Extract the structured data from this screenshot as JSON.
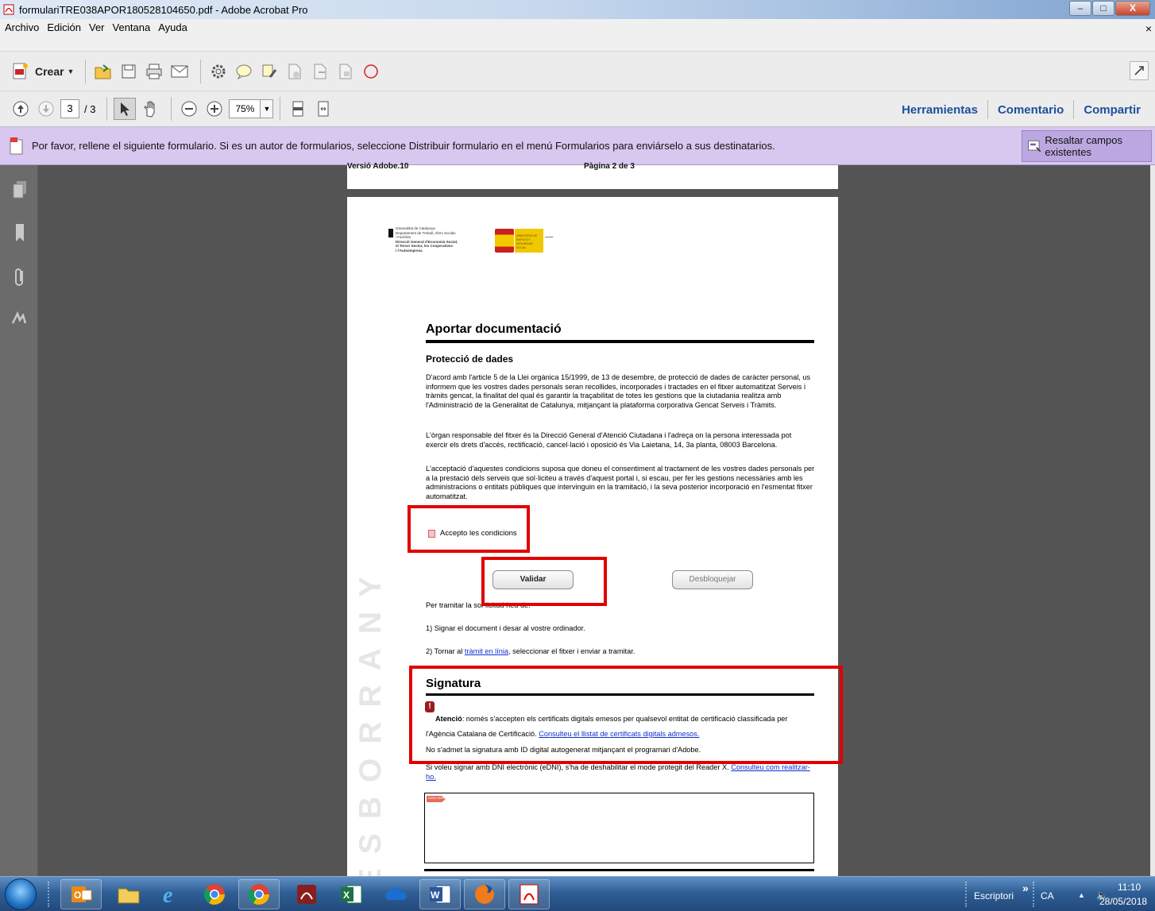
{
  "window": {
    "title": "formulariTRE038APOR180528104650.pdf - Adobe Acrobat Pro",
    "min_label": "–",
    "max_label": "□",
    "close_label": "X"
  },
  "menu": {
    "items": [
      "Archivo",
      "Edición",
      "Ver",
      "Ventana",
      "Ayuda"
    ],
    "close_label": "×"
  },
  "toolbar": {
    "crear_label": "Crear",
    "icons": [
      "create-pdf-icon",
      "open-folder-icon",
      "save-icon",
      "print-icon",
      "email-icon",
      "settings-gear-icon",
      "comment-bubble-icon",
      "highlight-icon",
      "page-tools-icon",
      "page-export-icon",
      "page-combine-icon",
      "stop-circle-icon"
    ]
  },
  "nav": {
    "current_page": "3",
    "total_pages": "/ 3",
    "zoom": "75%",
    "links": [
      "Herramientas",
      "Comentario",
      "Compartir"
    ]
  },
  "formbar": {
    "message": "Por favor, rellene el siguiente formulario. Si es un autor de formularios, seleccione Distribuir formulario en el menú Formularios para enviárselo a sus destinatarios.",
    "highlight_button": "Resaltar campos existentes"
  },
  "prev_page": {
    "version": "Versió Adobe.10",
    "page": "Pàgina 2 de 3"
  },
  "document": {
    "logo_lines": [
      "Generalitat de Catalunya",
      "Departament de Treball, Afers Socials",
      "i Famílies",
      "Direcció General d'Economia Social,",
      "el Tercer Sector, les Cooperatives",
      "i l'Autoempresa"
    ],
    "logo2_text": "MINISTERIO DE EMPLEO Y SEGURIDAD SOCIAL",
    "title": "Aportar documentació",
    "subtitle": "Protecció de dades",
    "para1": "D'acord amb l'article 5 de la Llei orgànica 15/1999, de 13 de desembre, de protecció de dades de caràcter personal, us informem que les vostres dades personals seran recollides, incorporades i tractades en el fitxer automatitzat Serveis i tràmits gencat, la finalitat del qual és garantir la traçabilitat de totes les gestions que la ciutadania realitza amb l'Administració de la Generalitat de Catalunya, mitjançant la plataforma corporativa Gencat Serveis i Tràmits.",
    "para2": "L'òrgan responsable del fitxer és la Direcció General d'Atenció Ciutadana i l'adreça on la persona interessada pot exercir els drets d'accés, rectificació, cancel·lació i oposició és Via Laietana, 14, 3a planta, 08003 Barcelona.",
    "para3": "L'acceptació d'aquestes condicions suposa que doneu el consentiment al tractament de les vostres dades personals per a la prestació dels serveis que sol·liciteu a través d'aquest portal i, si escau, per fer les gestions necessàries amb les administracions o entitats públiques que intervinguin en la tramitació, i la seva posterior incorporació en l'esmentat fitxer automatitzat.",
    "checkbox_label": "Accepto les condicions",
    "validar": "Validar",
    "desbloquejar": "Desbloquejar",
    "tramitar_intro": "Per tramitar la sol·licitud heu de:",
    "step1": "1)  Signar el document i desar al vostre ordinador.",
    "step2_prefix": "2)  Tornar al ",
    "step2_link": "tràmit en línia",
    "step2_suffix": ", seleccionar el fitxer i enviar a tramitar.",
    "signatura_title": "Signatura",
    "atencio_bold": "Atenció",
    "atencio_text": ": només s'accepten els certificats digitals emesos per qualsevol entitat de certificació classificada per l'Agència Catalana de Certificació. ",
    "atencio_link": "Consulteu el llistat de certificats digitals admesos.",
    "no_admet": "No s'admet la signatura amb ID digital autogenerat mitjançant el programari d'Adobe.",
    "dni_text": "Si voleu signar amb DNI electrònic (eDNI), s'ha de deshabilitar el mode protegit del Reader X. ",
    "dni_link": "Consulteu com realitzar-ho.",
    "sig_tag": "SIGN HERE",
    "watermark": "ESBORRANY"
  },
  "taskbar": {
    "apps": [
      "outlook-icon",
      "file-explorer-icon",
      "internet-explorer-icon",
      "chrome-icon",
      "chrome-icon",
      "acrobat-pro-icon",
      "excel-icon",
      "onedrive-cloud-icon",
      "word-icon",
      "firefox-icon",
      "acrobat-reader-icon"
    ],
    "desktop_label": "Escriptori",
    "chevron": "»",
    "lang": "CA",
    "time": "11:10",
    "date": "28/05/2018"
  }
}
